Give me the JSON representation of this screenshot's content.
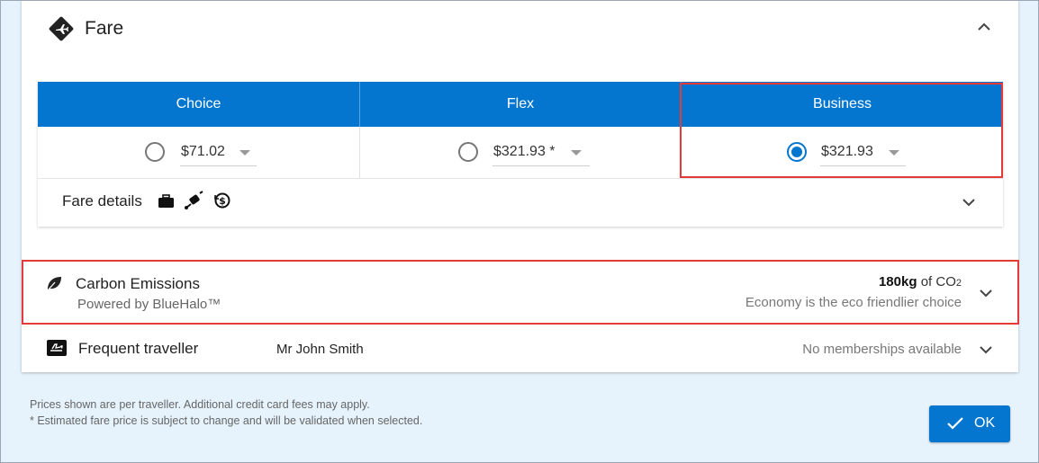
{
  "fare": {
    "title": "Fare",
    "columns": [
      {
        "name": "Choice",
        "price": "$71.02",
        "selected": false
      },
      {
        "name": "Flex",
        "price": "$321.93 *",
        "selected": false
      },
      {
        "name": "Business",
        "price": "$321.93",
        "selected": true
      }
    ],
    "details_label": "Fare details"
  },
  "carbon": {
    "title": "Carbon Emissions",
    "subtitle": "Powered by BlueHalo™",
    "amount": "180kg",
    "amount_of": "of CO",
    "amount_sub": "2",
    "note": "Economy is the eco friendlier choice"
  },
  "frequent_traveller": {
    "title": "Frequent traveller",
    "name": "Mr John Smith",
    "status": "No memberships available"
  },
  "footer": {
    "line1": "Prices shown are per traveller. Additional credit card fees may apply.",
    "line2": "* Estimated fare price is subject to change and will be validated when selected.",
    "ok_label": "OK"
  },
  "colors": {
    "accent": "#0476cf",
    "highlight": "#e53a3a"
  },
  "icons": [
    "ticket-icon",
    "chevron-up-icon",
    "chevron-down-icon",
    "briefcase-icon",
    "luggage-icon",
    "refund-icon",
    "leaf-icon",
    "plane-card-icon",
    "check-icon"
  ]
}
